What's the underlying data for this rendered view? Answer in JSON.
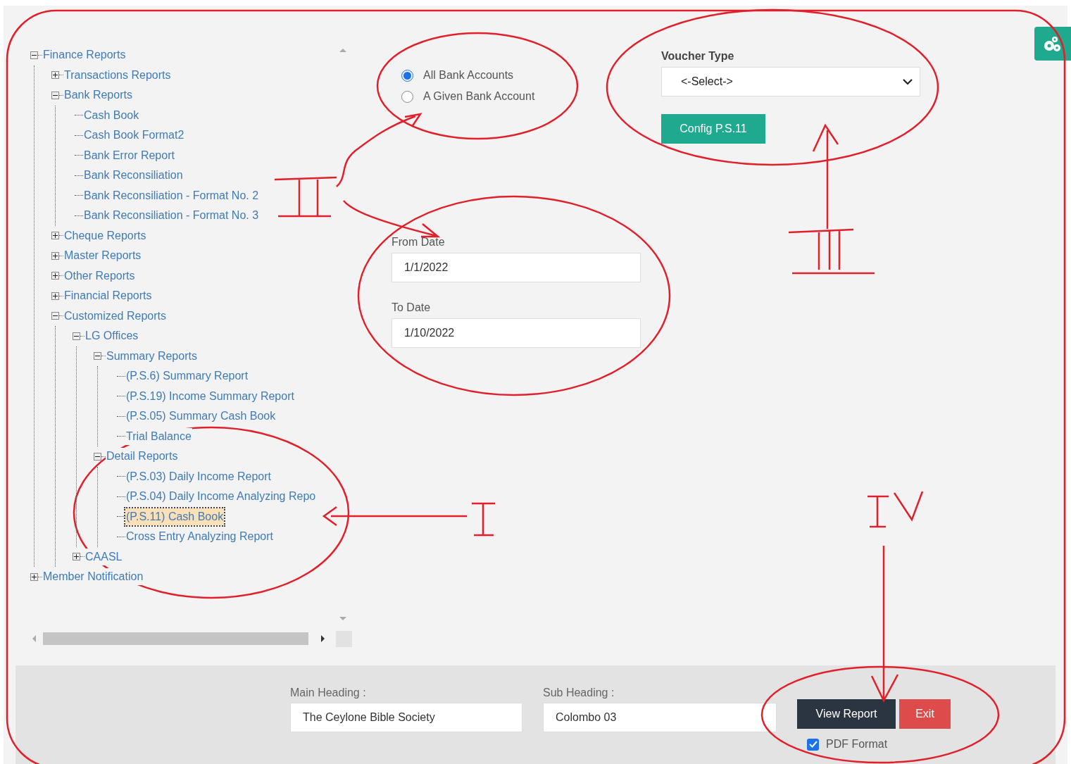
{
  "tree": [
    {
      "label": "Finance Reports",
      "expanded": true,
      "selected": false,
      "children": [
        {
          "label": "Transactions Reports",
          "expanded": false,
          "selected": false
        },
        {
          "label": "Bank Reports",
          "expanded": true,
          "selected": false,
          "children": [
            {
              "label": "Cash Book",
              "selected": false
            },
            {
              "label": "Cash Book Format2",
              "selected": false
            },
            {
              "label": "Bank Error Report",
              "selected": false
            },
            {
              "label": "Bank Reconsiliation",
              "selected": false
            },
            {
              "label": "Bank Reconsiliation - Format No. 2",
              "selected": false
            },
            {
              "label": "Bank Reconsiliation - Format No. 3",
              "selected": false
            }
          ]
        },
        {
          "label": "Cheque Reports",
          "expanded": false,
          "selected": false
        },
        {
          "label": "Master Reports",
          "expanded": false,
          "selected": false
        },
        {
          "label": "Other Reports",
          "expanded": false,
          "selected": false
        },
        {
          "label": "Financial Reports",
          "expanded": false,
          "selected": false
        },
        {
          "label": "Customized Reports",
          "expanded": true,
          "selected": false,
          "children": [
            {
              "label": "LG Offices",
              "expanded": true,
              "selected": false,
              "children": [
                {
                  "label": "Summary Reports",
                  "expanded": true,
                  "selected": false,
                  "children": [
                    {
                      "label": "(P.S.6) Summary Report",
                      "selected": false
                    },
                    {
                      "label": "(P.S.19) Income Summary Report",
                      "selected": false
                    },
                    {
                      "label": "(P.S.05) Summary Cash Book",
                      "selected": false
                    },
                    {
                      "label": "Trial Balance",
                      "selected": false
                    }
                  ]
                },
                {
                  "label": "Detail Reports",
                  "expanded": true,
                  "selected": false,
                  "children": [
                    {
                      "label": "(P.S.03) Daily Income Report",
                      "selected": false
                    },
                    {
                      "label": "(P.S.04) Daily Income Analyzing Repo",
                      "selected": false
                    },
                    {
                      "label": "(P.S.11) Cash Book",
                      "selected": true
                    },
                    {
                      "label": "Cross Entry Analyzing Report",
                      "selected": false
                    }
                  ]
                }
              ]
            },
            {
              "label": "CAASL",
              "expanded": false,
              "selected": false
            }
          ]
        }
      ]
    },
    {
      "label": "Member Notification",
      "expanded": false,
      "selected": false
    }
  ],
  "bank_scope": [
    {
      "label": "All Bank Accounts",
      "selected": true
    },
    {
      "label": "A Given Bank Account",
      "selected": false
    }
  ],
  "from_date": {
    "label": "From Date",
    "value": "1/1/2022"
  },
  "to_date": {
    "label": "To Date",
    "value": "1/10/2022"
  },
  "voucher_type": {
    "label": "Voucher Type",
    "value": "<-Select->"
  },
  "config_button": "Config P.S.11",
  "footer": {
    "main_heading": {
      "label": "Main Heading :",
      "value": "The Ceylone Bible Society"
    },
    "sub_heading": {
      "label": "Sub Heading :",
      "value": "Colombo 03"
    },
    "buttons": [
      {
        "label": "View Report",
        "kind": "primary"
      },
      {
        "label": "Exit",
        "kind": "danger"
      }
    ],
    "pdf_format": {
      "label": "PDF Format",
      "checked": true
    }
  }
}
